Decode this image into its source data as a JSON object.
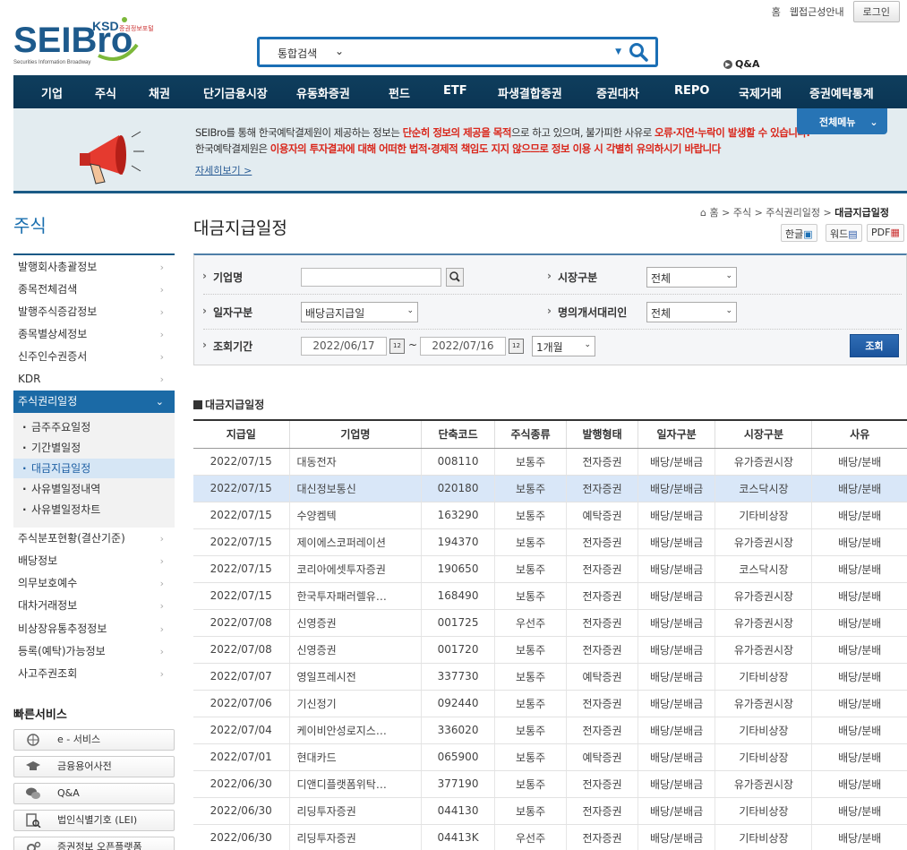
{
  "brand": {
    "logo_text": "SEIBro",
    "logo_sub": "Securities Information Broadway",
    "ksd": "KSD",
    "ksd_sub": "증권정보포털"
  },
  "util": {
    "home": "홈",
    "accessibility": "웹접근성안내",
    "login": "로그인"
  },
  "search": {
    "scope": "통합검색",
    "placeholder": ""
  },
  "qna_top": "Q&A",
  "gnb": [
    "기업",
    "주식",
    "채권",
    "단기금융시장",
    "유동화증권",
    "펀드",
    "ETF",
    "파생결합증권",
    "증권대차",
    "REPO",
    "국제거래",
    "증권예탁통계"
  ],
  "banner": {
    "l1_a": "SEIBro를 통해 한국예탁결제원이 제공하는 정보는 ",
    "l1_b": "단순히 정보의 제공을 목적",
    "l1_c": "으로 하고 있으며, 불가피한 사유로 ",
    "l1_d": "오류·지연·누락이 발생할 수 있습니다.",
    "l2_a": "한국예탁결제원은 ",
    "l2_b": "이용자의 투자결과에 대해 어떠한 법적·경제적 책임도 지지 않으므로 정보 이용 시 각별히 유의하시기 바랍니다",
    "more": "자세히보기 >",
    "allmenu": "전체메뉴"
  },
  "lnb": {
    "title": "주식",
    "items": [
      "발행회사총괄정보",
      "종목전체검색",
      "발행주식증감정보",
      "종목별상세정보",
      "신주인수권증서",
      "KDR",
      "주식권리일정"
    ],
    "sub": [
      "금주주요일정",
      "기간별일정",
      "대금지급일정",
      "사유별일정내역",
      "사유별일정차트"
    ],
    "items2": [
      "주식분포현황(결산기준)",
      "배당정보",
      "의무보호예수",
      "대차거래정보",
      "비상장유통추정정보",
      "등록(예탁)가능정보",
      "사고주권조회"
    ]
  },
  "quick": {
    "title": "빠른서비스",
    "items": [
      "e - 서비스",
      "금융용어사전",
      "Q&A",
      "법인식별기호 (LEI)",
      "증권정보 오픈플랫폼"
    ]
  },
  "page": {
    "title": "대금지급일정",
    "crumb_home": "홈",
    "crumb_1": "주식",
    "crumb_2": "주식권리일정",
    "crumb_3": "대금지급일정",
    "btn_hangul": "한글",
    "btn_word": "워드",
    "btn_pdf": "PDF"
  },
  "form": {
    "company_label": "기업명",
    "company_value": "",
    "market_label": "시장구분",
    "market_value": "전체",
    "datetype_label": "일자구분",
    "datetype_value": "배당금지급일",
    "agent_label": "명의개서대리인",
    "agent_value": "전체",
    "period_label": "조회기간",
    "date_from": "2022/06/17",
    "date_sep": "~",
    "date_to": "2022/07/16",
    "period_value": "1개월",
    "submit": "조회"
  },
  "table": {
    "section_title": "대금지급일정",
    "headers": [
      "지급일",
      "기업명",
      "단축코드",
      "주식종류",
      "발행형태",
      "일자구분",
      "시장구분",
      "사유"
    ],
    "rows": [
      [
        "2022/07/15",
        "대동전자",
        "008110",
        "보통주",
        "전자증권",
        "배당/분배금",
        "유가증권시장",
        "배당/분배"
      ],
      [
        "2022/07/15",
        "대신정보통신",
        "020180",
        "보통주",
        "전자증권",
        "배당/분배금",
        "코스닥시장",
        "배당/분배"
      ],
      [
        "2022/07/15",
        "수양켐텍",
        "163290",
        "보통주",
        "예탁증권",
        "배당/분배금",
        "기타비상장",
        "배당/분배"
      ],
      [
        "2022/07/15",
        "제이에스코퍼레이션",
        "194370",
        "보통주",
        "전자증권",
        "배당/분배금",
        "유가증권시장",
        "배당/분배"
      ],
      [
        "2022/07/15",
        "코리아에셋투자증권",
        "190650",
        "보통주",
        "전자증권",
        "배당/분배금",
        "코스닥시장",
        "배당/분배"
      ],
      [
        "2022/07/15",
        "한국투자패러렐유…",
        "168490",
        "보통주",
        "전자증권",
        "배당/분배금",
        "유가증권시장",
        "배당/분배"
      ],
      [
        "2022/07/08",
        "신영증권",
        "001725",
        "우선주",
        "전자증권",
        "배당/분배금",
        "유가증권시장",
        "배당/분배"
      ],
      [
        "2022/07/08",
        "신영증권",
        "001720",
        "보통주",
        "전자증권",
        "배당/분배금",
        "유가증권시장",
        "배당/분배"
      ],
      [
        "2022/07/07",
        "영일프레시전",
        "337730",
        "보통주",
        "예탁증권",
        "배당/분배금",
        "기타비상장",
        "배당/분배"
      ],
      [
        "2022/07/06",
        "기신정기",
        "092440",
        "보통주",
        "전자증권",
        "배당/분배금",
        "유가증권시장",
        "배당/분배"
      ],
      [
        "2022/07/04",
        "케이비안성로지스…",
        "336020",
        "보통주",
        "전자증권",
        "배당/분배금",
        "기타비상장",
        "배당/분배"
      ],
      [
        "2022/07/01",
        "현대카드",
        "065900",
        "보통주",
        "예탁증권",
        "배당/분배금",
        "기타비상장",
        "배당/분배"
      ],
      [
        "2022/06/30",
        "디앤디플랫폼위탁…",
        "377190",
        "보통주",
        "전자증권",
        "배당/분배금",
        "유가증권시장",
        "배당/분배"
      ],
      [
        "2022/06/30",
        "리딩투자증권",
        "044130",
        "보통주",
        "전자증권",
        "배당/분배금",
        "기타비상장",
        "배당/분배"
      ],
      [
        "2022/06/30",
        "리딩투자증권",
        "04413K",
        "우선주",
        "전자증권",
        "배당/분배금",
        "기타비상장",
        "배당/분배"
      ]
    ],
    "highlight_row": 1
  },
  "colors": {
    "brand_blue": "#1b6fb5",
    "gnb_bg": "#0f3e5d",
    "accent_red": "#d9271c",
    "highlight": "#d9e7f8"
  }
}
